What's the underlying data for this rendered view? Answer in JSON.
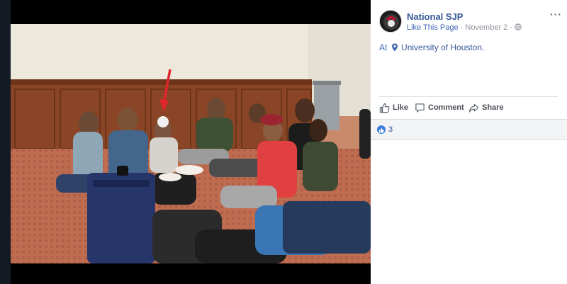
{
  "post": {
    "page_name": "National SJP",
    "like_page_label": "Like This Page",
    "separator": "·",
    "date": "November 2",
    "privacy_icon": "globe-icon",
    "more_icon": "ellipsis-icon",
    "more_label": "···",
    "location_prefix": "At",
    "location_icon": "map-pin-icon",
    "location_name": "University of Houston."
  },
  "actions": {
    "like_label": "Like",
    "comment_label": "Comment",
    "share_label": "Share"
  },
  "reactions": {
    "icon": "like-reaction-icon",
    "count": "3"
  },
  "colors": {
    "link_blue": "#365899",
    "accent_blue": "#4267b2",
    "muted_gray": "#90949c",
    "reaction_bar_bg": "#f2f3f5",
    "annotation_arrow_red": "#e0262b"
  }
}
